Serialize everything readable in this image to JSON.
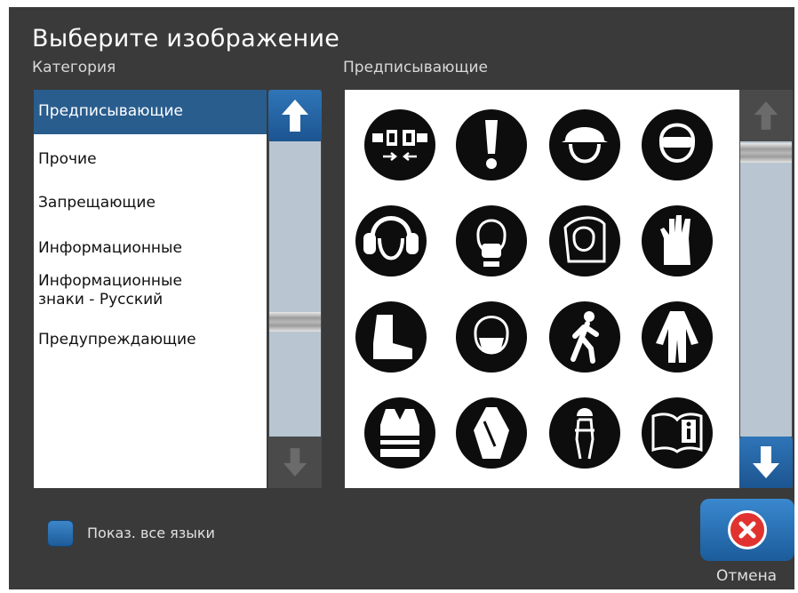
{
  "dialog": {
    "title": "Выберите изображение"
  },
  "category": {
    "label": "Категория",
    "items": [
      {
        "label": "Предписывающие",
        "selected": true
      },
      {
        "label": "Прочие"
      },
      {
        "label": "Запрещающие"
      },
      {
        "label": "Информационные"
      },
      {
        "label": "Информационные знаки - Русский"
      },
      {
        "label": "Предупреждающие"
      }
    ]
  },
  "images": {
    "label": "Предписывающие",
    "symbols": [
      "seat-belt-icon",
      "exclamation-icon",
      "hard-hat-icon",
      "safety-goggles-icon",
      "ear-protection-icon",
      "dust-mask-icon",
      "face-shield-icon",
      "protective-gloves-icon",
      "safety-boots-icon",
      "respirator-icon",
      "pedestrian-route-icon",
      "protective-coverall-icon",
      "high-vis-vest-icon",
      "protective-apron-icon",
      "safety-harness-icon",
      "read-manual-icon"
    ]
  },
  "show_all_languages": {
    "label": "Показ. все языки",
    "checked": false
  },
  "cancel": {
    "label": "Отмена"
  },
  "colors": {
    "accent": "#295d8e",
    "background": "#3a3a3a",
    "cancel_red": "#e0332f"
  }
}
